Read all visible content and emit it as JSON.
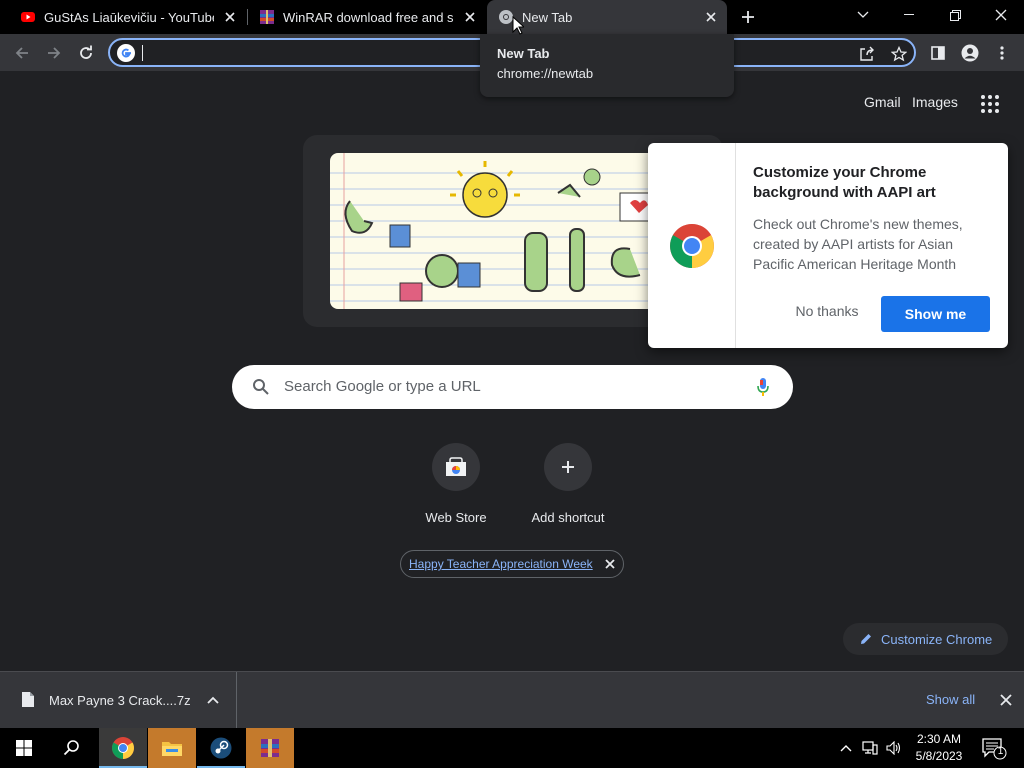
{
  "tabs": [
    {
      "title": "GuStAs Liaūkevičiu - YouTube",
      "icon": "youtube-icon"
    },
    {
      "title": "WinRAR download free and supp",
      "icon": "winrar-icon"
    },
    {
      "title": "New Tab",
      "icon": "chrome-icon",
      "active": true
    }
  ],
  "tooltip": {
    "title": "New Tab",
    "url": "chrome://newtab"
  },
  "omnibox": {
    "value": ""
  },
  "top_links": {
    "gmail": "Gmail",
    "images": "Images"
  },
  "search": {
    "placeholder": "Search Google or type a URL"
  },
  "shortcuts": [
    {
      "label": "Web Store",
      "icon": "web-store-icon"
    },
    {
      "label": "Add shortcut",
      "icon": "plus-icon"
    }
  ],
  "promo": {
    "link": "Happy Teacher Appreciation Week"
  },
  "customize": {
    "label": "Customize Chrome"
  },
  "iph": {
    "title": "Customize your Chrome background with AAPI art",
    "body": "Check out Chrome's new themes, created by AAPI artists for Asian Pacific American Heritage Month",
    "dismiss": "No thanks",
    "confirm": "Show me"
  },
  "download": {
    "filename": "Max Payne 3 Crack....7z",
    "show_all": "Show all"
  },
  "taskbar": {
    "apps": [
      "start-icon",
      "search-icon",
      "chrome-icon",
      "file-explorer-icon",
      "steam-icon",
      "winrar-icon"
    ],
    "time": "2:30 AM",
    "date": "5/8/2023",
    "notification_count": "1"
  },
  "colors": {
    "accent": "#8ab4f8",
    "primary_button": "#1a73e8",
    "background": "#202124",
    "toolbar": "#35363a"
  }
}
